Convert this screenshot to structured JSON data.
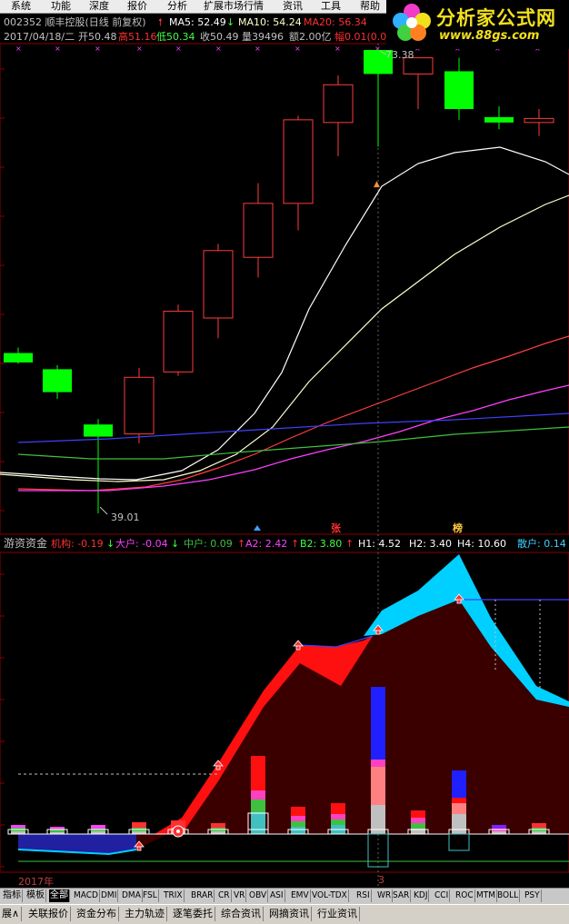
{
  "menu": [
    "系统",
    "功能",
    "深度",
    "报价",
    "分析",
    "扩展市场行情",
    "资讯",
    "工具",
    "帮助"
  ],
  "logo": {
    "title": "分析家公式网",
    "url": "www.88gs.com"
  },
  "stock": {
    "title": "002352 顺丰控股(日线 前复权)",
    "ma5": "MA5: 52.49",
    "ma10": "MA10: 54.24",
    "ma20": "MA20: 56.34",
    "date_row": "2017/04/18/二",
    "open": "开50.48",
    "high": "高51.16",
    "low": "低50.34",
    "close": "收50.49",
    "volume": "量39496",
    "amount": "额2.00亿",
    "amplitude": "幅0.01(0.0",
    "price_high_label": "73.38",
    "price_low_label": "39.01",
    "zhang_marker": "张",
    "bang_marker": "榜"
  },
  "indicator": {
    "name": "游资资金",
    "jigou": "机构: -0.19",
    "dahu": "大户: -0.04",
    "zhonghu": "中户: 0.09",
    "a2": "A2: 2.42",
    "b2": "B2: 3.80",
    "h1": "H1: 4.52",
    "h2": "H2: 3.40",
    "h4": "H4: 10.60",
    "sanhu": "散户: 0.14"
  },
  "time_axis": {
    "year": "2017年",
    "month": "3"
  },
  "tabs": [
    "指标",
    "模板",
    "全部",
    "MACD",
    "DMI",
    "DMA",
    "FSL",
    "TRIX",
    "BRAR",
    "CR",
    "VR",
    "OBV",
    "ASI",
    "EMV",
    "VOL-TDX",
    "RSI",
    "WR",
    "SAR",
    "KDJ",
    "CCI",
    "ROC",
    "MTM",
    "BOLL",
    "PSY"
  ],
  "active_tab": "全部",
  "bottom_tabs": [
    "展∧",
    "关联报价",
    "资金分布",
    "主力轨迹",
    "逐笔委托",
    "综合资讯",
    "网摘资讯",
    "行业资讯"
  ],
  "colors": {
    "up": "#ff3c3c",
    "down": "#00ff00",
    "ma5": "#ffffff",
    "ma10": "#ffffcc",
    "ma20": "#ff4040",
    "ma30": "#ff40ff",
    "ma60": "#4040ff",
    "ma120": "#40c040",
    "cyan": "#00d0ff",
    "darkred": "#3a0000"
  },
  "candles": [
    {
      "o": 50.9,
      "h": 51.3,
      "l": 50.1,
      "c": 50.2
    },
    {
      "o": 49.7,
      "h": 50.0,
      "l": 47.5,
      "c": 48.0
    },
    {
      "o": 45.6,
      "h": 46.0,
      "l": 39.01,
      "c": 44.7
    },
    {
      "o": 44.9,
      "h": 49.8,
      "l": 44.2,
      "c": 49.1
    },
    {
      "o": 49.5,
      "h": 54.5,
      "l": 49.2,
      "c": 54.0
    },
    {
      "o": 53.5,
      "h": 59.0,
      "l": 52.0,
      "c": 58.5
    },
    {
      "o": 58.0,
      "h": 63.5,
      "l": 56.5,
      "c": 62.0
    },
    {
      "o": 62.0,
      "h": 68.5,
      "l": 60.0,
      "c": 68.2
    },
    {
      "o": 68.0,
      "h": 71.5,
      "l": 65.5,
      "c": 70.8
    },
    {
      "o": 73.38,
      "h": 73.38,
      "l": 66.2,
      "c": 71.6
    },
    {
      "o": 71.6,
      "h": 72.4,
      "l": 69.0,
      "c": 72.8
    },
    {
      "o": 71.8,
      "h": 72.8,
      "l": 68.2,
      "c": 69.0
    },
    {
      "o": 68.4,
      "h": 69.2,
      "l": 67.5,
      "c": 68.0
    },
    {
      "o": 68.0,
      "h": 69.0,
      "l": 67.0,
      "c": 68.3
    }
  ]
}
